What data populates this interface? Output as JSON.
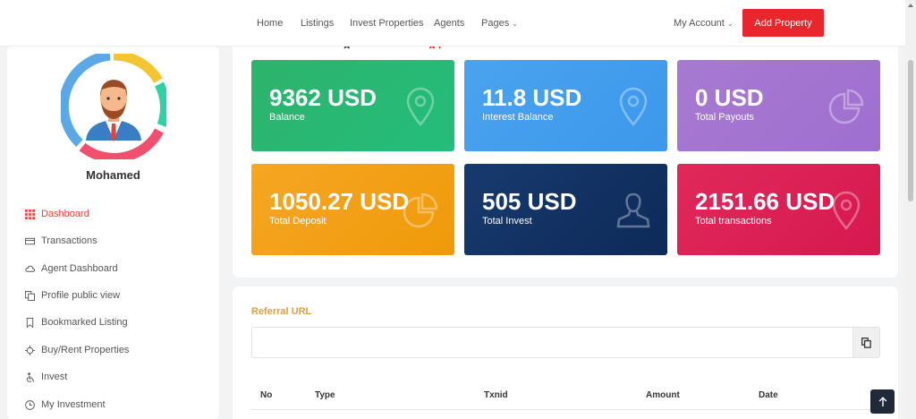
{
  "nav": {
    "links": [
      "Home",
      "Listings",
      "Invest Properties",
      "Agents",
      "Pages"
    ],
    "account": "My Account",
    "add_property": "Add Property"
  },
  "sidebar": {
    "username": "Mohamed",
    "items": [
      {
        "label": "Dashboard",
        "icon": "grid-icon",
        "active": true
      },
      {
        "label": "Transactions",
        "icon": "card-icon"
      },
      {
        "label": "Agent Dashboard",
        "icon": "cloud-icon"
      },
      {
        "label": "Profile public view",
        "icon": "copy-icon"
      },
      {
        "label": "Bookmarked Listing",
        "icon": "bookmark-icon"
      },
      {
        "label": "Buy/Rent Properties",
        "icon": "target-icon"
      },
      {
        "label": "Invest",
        "icon": "person-icon"
      },
      {
        "label": "My Investment",
        "icon": "clock-icon"
      }
    ]
  },
  "stats": {
    "heading_visible": "g",
    "heading_red": "g (",
    "cards": [
      {
        "amount": "9362 USD",
        "label": "Balance",
        "color": "#27b573",
        "icon": "map-pin-icon"
      },
      {
        "amount": "11.8 USD",
        "label": "Interest Balance",
        "color": "#439eed",
        "icon": "map-pin-icon"
      },
      {
        "amount": "0 USD",
        "label": "Total Payouts",
        "color": "#a375d0",
        "icon": "pie-chart-icon"
      },
      {
        "amount": "1050.27 USD",
        "label": "Total Deposit",
        "color": "#f3a116",
        "icon": "pie-chart-icon"
      },
      {
        "amount": "505 USD",
        "label": "Total Invest",
        "color": "#122f60",
        "icon": "user-icon"
      },
      {
        "amount": "2151.66 USD",
        "label": "Total transactions",
        "color": "#da1f55",
        "icon": "map-pin-icon"
      }
    ]
  },
  "referral": {
    "title": "Referral URL",
    "url": "",
    "columns": [
      "No",
      "Type",
      "Txnid",
      "Amount",
      "Date"
    ]
  },
  "colors": {
    "accent_red": "#e8262c",
    "referral_title": "#d4a24a"
  }
}
